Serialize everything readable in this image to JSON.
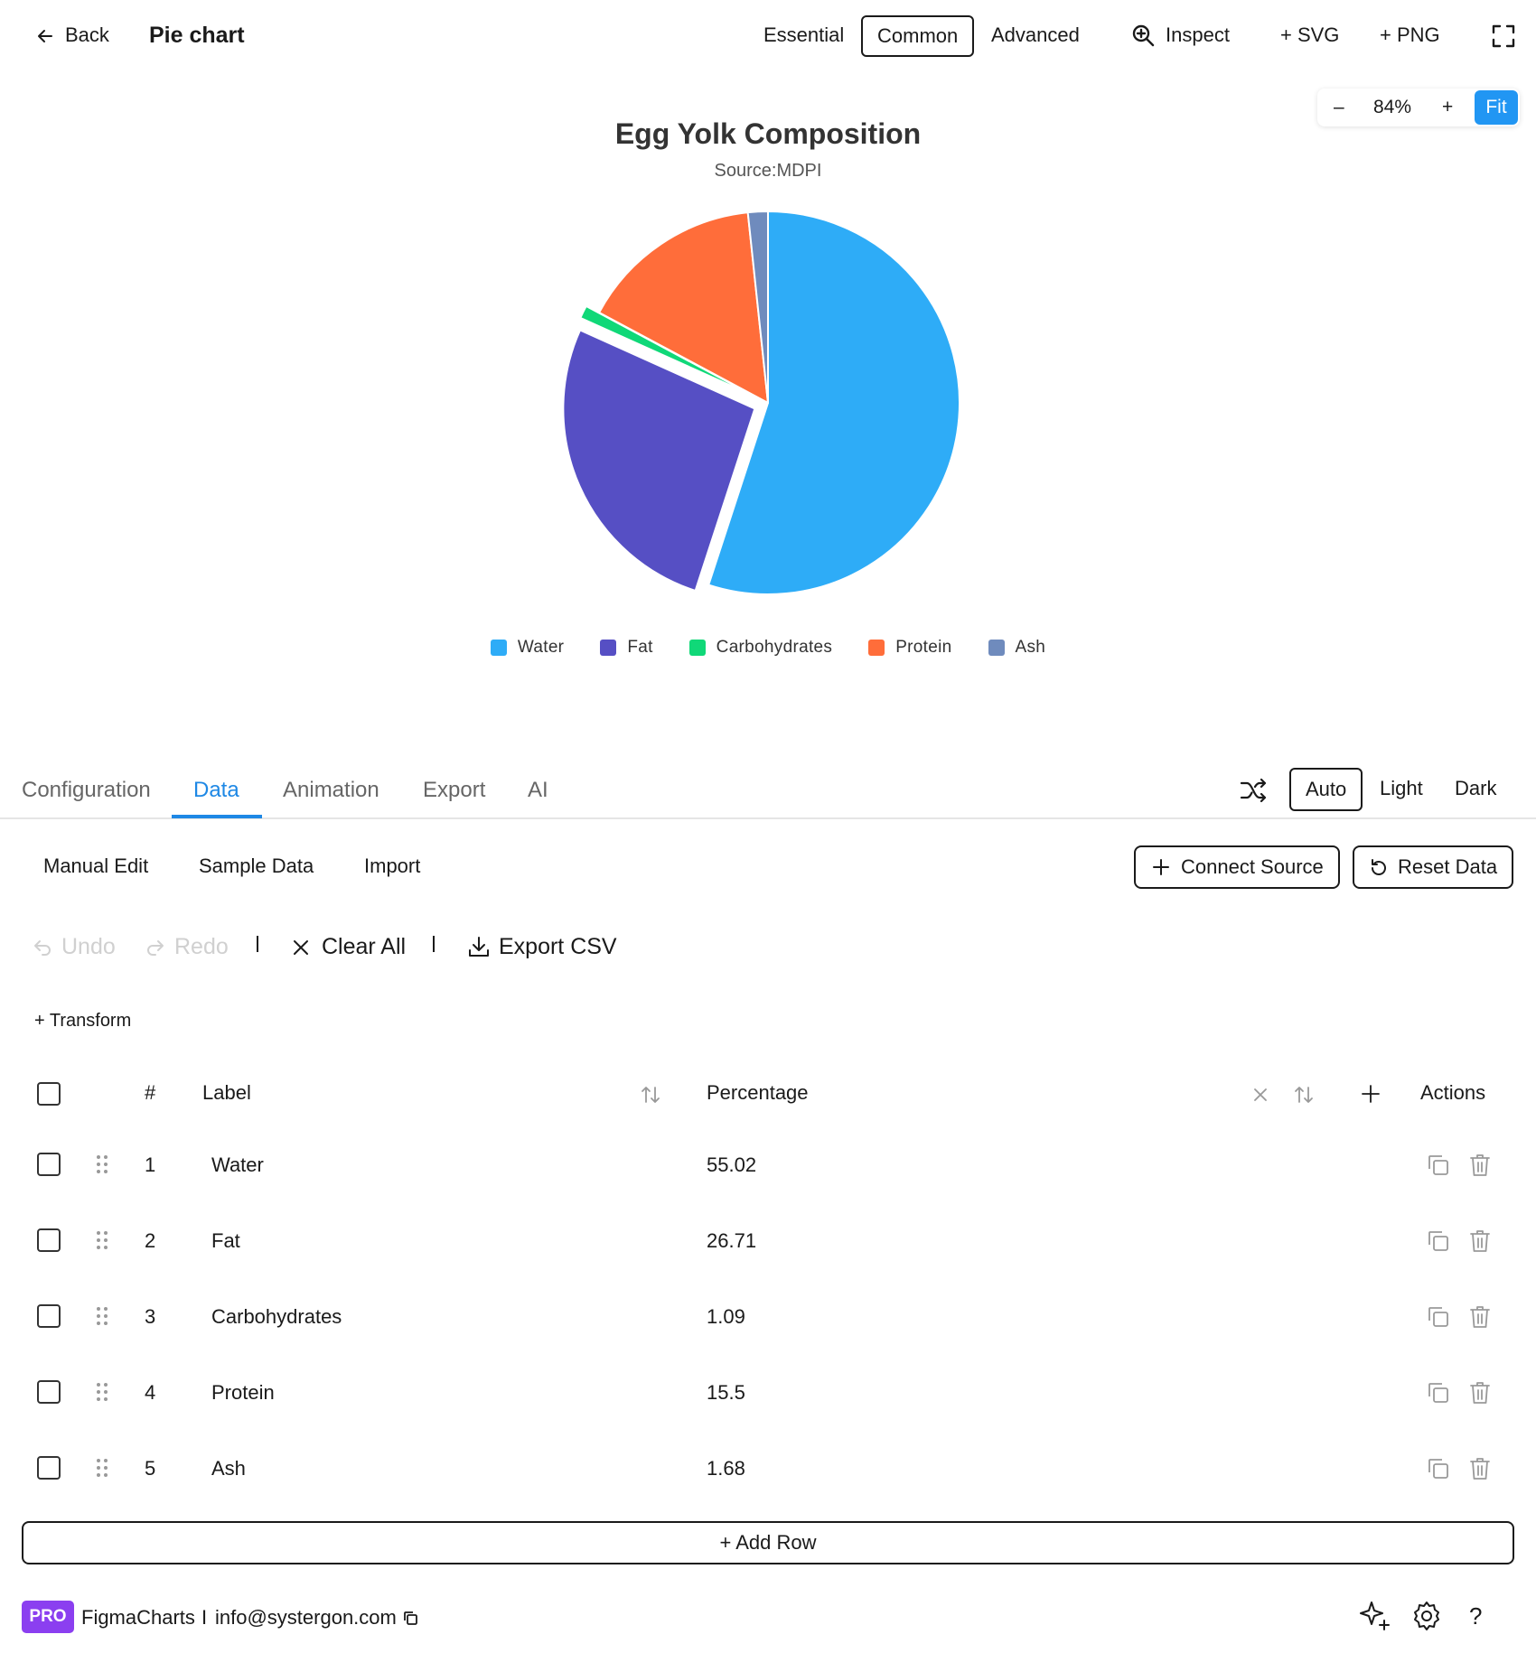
{
  "topbar": {
    "back_label": "Back",
    "page_title": "Pie chart",
    "modes": [
      "Essential",
      "Common",
      "Advanced"
    ],
    "active_mode": "Common",
    "inspect_label": "Inspect",
    "svg_label": "+ SVG",
    "png_label": "+ PNG"
  },
  "zoom": {
    "minus": "–",
    "value": "84%",
    "plus": "+",
    "fit": "Fit"
  },
  "chart_data": {
    "type": "pie",
    "title": "Egg Yolk Composition",
    "subtitle": "Source:MDPI",
    "categories": [
      "Water",
      "Fat",
      "Carbohydrates",
      "Protein",
      "Ash"
    ],
    "values": [
      55.02,
      26.71,
      1.09,
      15.5,
      1.68
    ],
    "colors": [
      "#2eacf7",
      "#564fc4",
      "#10d878",
      "#ff6d3a",
      "#6f8bbd"
    ],
    "exploded": [
      "Fat",
      "Carbohydrates"
    ],
    "legend_position": "bottom"
  },
  "tabs": {
    "items": [
      "Configuration",
      "Data",
      "Animation",
      "Export",
      "AI"
    ],
    "active": "Data",
    "themes": [
      "Auto",
      "Light",
      "Dark"
    ],
    "active_theme": "Auto"
  },
  "data_toolbar": {
    "manual_edit": "Manual Edit",
    "sample_data": "Sample Data",
    "import": "Import",
    "connect_source": "Connect Source",
    "reset_data": "Reset Data",
    "undo": "Undo",
    "redo": "Redo",
    "clear_all": "Clear All",
    "export_csv": "Export CSV",
    "transform": "+ Transform"
  },
  "table": {
    "headers": {
      "index": "#",
      "label": "Label",
      "percentage": "Percentage",
      "actions": "Actions"
    },
    "rows": [
      {
        "index": "1",
        "label": "Water",
        "value": "55.02"
      },
      {
        "index": "2",
        "label": "Fat",
        "value": "26.71"
      },
      {
        "index": "3",
        "label": "Carbohydrates",
        "value": "1.09"
      },
      {
        "index": "4",
        "label": "Protein",
        "value": "15.5"
      },
      {
        "index": "5",
        "label": "Ash",
        "value": "1.68"
      }
    ],
    "add_row": "+ Add Row"
  },
  "footer": {
    "badge": "PRO",
    "brand": "FigmaCharts",
    "separator": "I",
    "email": "info@systergon.com"
  }
}
